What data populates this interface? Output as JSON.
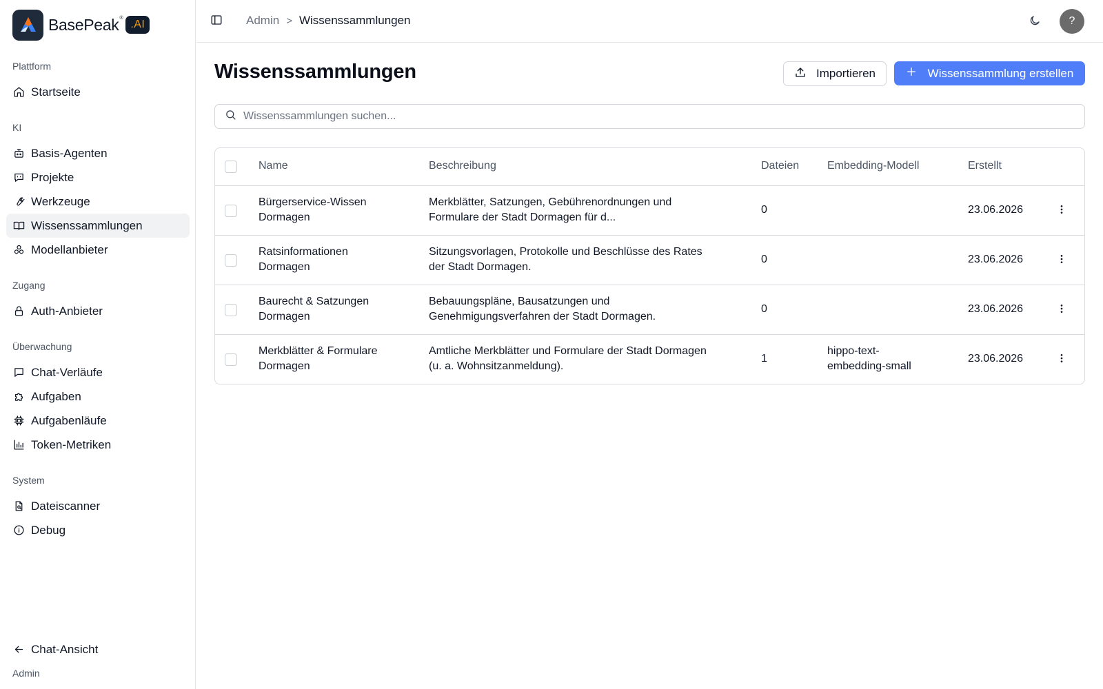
{
  "brand": {
    "name": "BasePeak",
    "reg": "®",
    "badge": ".AI"
  },
  "sidebar": {
    "sections": [
      {
        "label": "Plattform"
      },
      {
        "label": "KI"
      },
      {
        "label": "Zugang"
      },
      {
        "label": "Überwachung"
      },
      {
        "label": "System"
      }
    ],
    "items": [
      {
        "label": "Startseite",
        "icon": "home-icon"
      },
      {
        "label": "Basis-Agenten",
        "icon": "bot-icon"
      },
      {
        "label": "Projekte",
        "icon": "message-bot-icon"
      },
      {
        "label": "Werkzeuge",
        "icon": "wrench-icon"
      },
      {
        "label": "Wissenssammlungen",
        "icon": "book-icon",
        "active": true
      },
      {
        "label": "Modellanbieter",
        "icon": "boxes-icon"
      },
      {
        "label": "Auth-Anbieter",
        "icon": "lock-icon"
      },
      {
        "label": "Chat-Verläufe",
        "icon": "chat-icon"
      },
      {
        "label": "Aufgaben",
        "icon": "puzzle-icon"
      },
      {
        "label": "Aufgabenläufe",
        "icon": "cpu-icon"
      },
      {
        "label": "Token-Metriken",
        "icon": "bar-chart-icon"
      },
      {
        "label": "Dateiscanner",
        "icon": "file-scan-icon"
      },
      {
        "label": "Debug",
        "icon": "info-icon"
      }
    ],
    "back_label": "Chat-Ansicht",
    "footer_user": "Admin"
  },
  "header": {
    "breadcrumb_parent": "Admin",
    "breadcrumb_separator": ">",
    "breadcrumb_current": "Wissenssammlungen",
    "avatar_text": "?"
  },
  "main": {
    "title": "Wissenssammlungen",
    "import_label": "Importieren",
    "create_label": "Wissenssammlung erstellen",
    "search_placeholder": "Wissenssammlungen suchen...",
    "columns": [
      "Name",
      "Beschreibung",
      "Dateien",
      "Embedding-Modell",
      "Erstellt"
    ],
    "rows": [
      {
        "name_line1": "Bürgerservice-Wissen",
        "name_line2": "Dormagen",
        "desc_line1": "Merkblätter, Satzungen, Gebührenordnungen und",
        "desc_line2": "Formulare der Stadt Dormagen für d...",
        "files": "0",
        "model_line1": "",
        "model_line2": "",
        "created": "23.06.2026"
      },
      {
        "name_line1": "Ratsinformationen",
        "name_line2": "Dormagen",
        "desc_line1": "Sitzungsvorlagen, Protokolle und Beschlüsse des Rates",
        "desc_line2": "der Stadt Dormagen.",
        "files": "0",
        "model_line1": "",
        "model_line2": "",
        "created": "23.06.2026"
      },
      {
        "name_line1": "Baurecht & Satzungen",
        "name_line2": "Dormagen",
        "desc_line1": "Bebauungspläne, Bausatzungen und",
        "desc_line2": "Genehmigungsverfahren der Stadt Dormagen.",
        "files": "0",
        "model_line1": "",
        "model_line2": "",
        "created": "23.06.2026"
      },
      {
        "name_line1": "Merkblätter & Formulare",
        "name_line2": "Dormagen",
        "desc_line1": "Amtliche Merkblätter und Formulare der Stadt Dormagen",
        "desc_line2": "(u. a. Wohnsitzanmeldung).",
        "files": "1",
        "model_line1": "hippo-text-",
        "model_line2": "embedding-small",
        "created": "23.06.2026"
      }
    ]
  },
  "colors": {
    "accent": "#4f7ef8",
    "active_nav_bg": "#f1f2f4",
    "brand_badge_text": "#f59e0b",
    "border": "#d9dce1"
  }
}
